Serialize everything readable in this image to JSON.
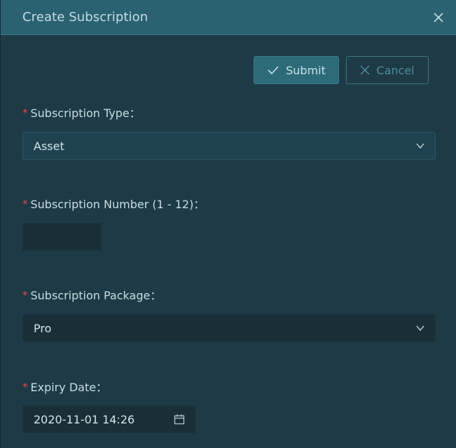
{
  "dialog": {
    "title": "Create Subscription",
    "close_icon": "close-icon"
  },
  "actions": {
    "submit_label": "Submit",
    "submit_icon": "check-icon",
    "cancel_label": "Cancel",
    "cancel_icon": "x-icon"
  },
  "form": {
    "subscription_type": {
      "label": "Subscription Type：",
      "value": "Asset",
      "required": true
    },
    "subscription_number": {
      "label": "Subscription Number (1 - 12)：",
      "value": "",
      "required": true
    },
    "subscription_package": {
      "label": "Subscription Package：",
      "value": "Pro",
      "required": true
    },
    "expiry_date": {
      "label": "Expiry Date：",
      "value": "2020-11-01 14:26",
      "required": true,
      "icon": "calendar-icon"
    },
    "required_marker": "*"
  },
  "colors": {
    "header_bg": "#2a6271",
    "body_bg": "#1d3a46",
    "required": "#e0484f",
    "submit_bg": "#2d6b79"
  }
}
